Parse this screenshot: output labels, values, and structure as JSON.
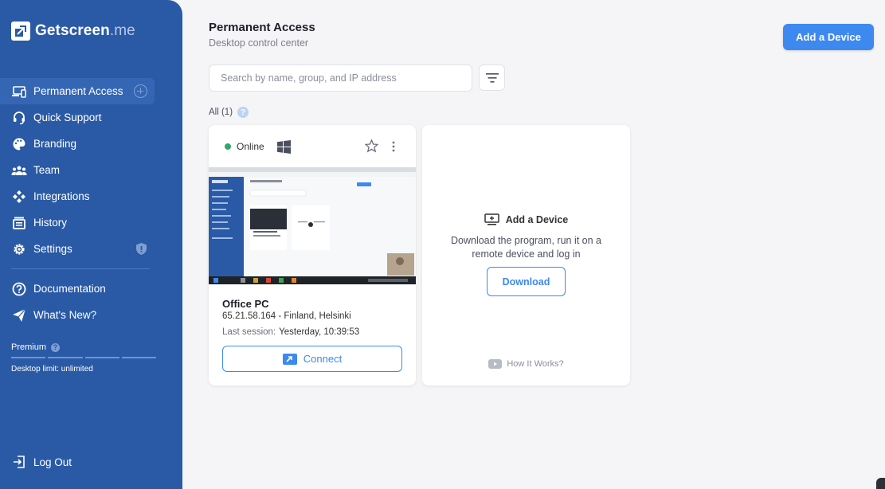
{
  "app": {
    "logo_main": "Getscreen",
    "logo_suffix": ".me"
  },
  "sidebar": {
    "items": [
      {
        "label": "Permanent Access",
        "icon": "desktop-icon",
        "active": true
      },
      {
        "label": "Quick Support",
        "icon": "headset-icon"
      },
      {
        "label": "Branding",
        "icon": "palette-icon"
      },
      {
        "label": "Team",
        "icon": "team-icon"
      },
      {
        "label": "Integrations",
        "icon": "integrations-icon"
      },
      {
        "label": "History",
        "icon": "history-icon"
      },
      {
        "label": "Settings",
        "icon": "gear-icon"
      }
    ],
    "secondary": [
      {
        "label": "Documentation",
        "icon": "help-circle-icon"
      },
      {
        "label": "What's New?",
        "icon": "paper-plane-icon"
      }
    ],
    "plan": {
      "label": "Premium",
      "limit": "Desktop limit: unlimited"
    },
    "logout": "Log Out"
  },
  "header": {
    "title": "Permanent Access",
    "subtitle": "Desktop control center",
    "add_device_label": "Add a Device"
  },
  "search": {
    "placeholder": "Search by name, group, and IP address",
    "value": ""
  },
  "filter": {
    "all_label": "All (1)"
  },
  "device": {
    "status": "Online",
    "status_color": "#2fa867",
    "name": "Office PC",
    "address": "65.21.58.164 - Finland, Helsinki",
    "last_session_label": "Last session:",
    "last_session_value": "Yesterday, 10:39:53",
    "connect_label": "Connect"
  },
  "add_card": {
    "title": "Add a Device",
    "description": "Download the program, run it on a remote device and log in",
    "download_label": "Download",
    "how_label": "How It Works?"
  },
  "colors": {
    "sidebar": "#2a5aa6",
    "accent": "#3d89f0"
  }
}
